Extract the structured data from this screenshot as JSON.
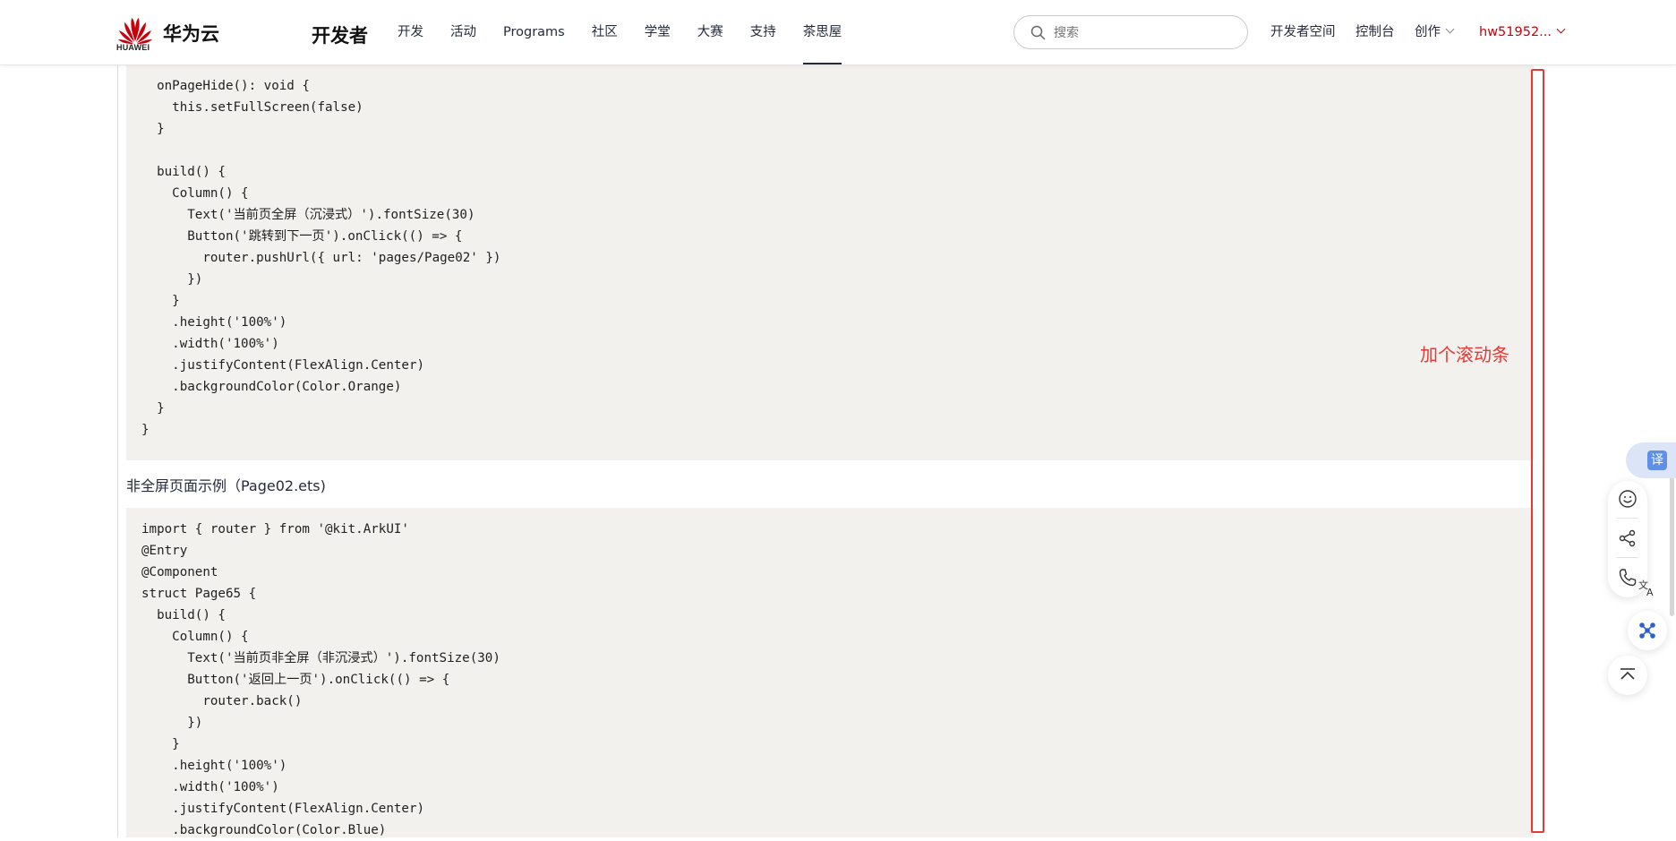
{
  "header": {
    "brand_logo_text": "HUAWEI",
    "brand_name": "华为云",
    "section_title": "开发者",
    "nav": [
      "开发",
      "活动",
      "Programs",
      "社区",
      "学堂",
      "大赛",
      "支持",
      "茶思屋"
    ],
    "active_nav_index": 7,
    "search_placeholder": "搜索",
    "links": {
      "dev_space": "开发者空间",
      "console": "控制台",
      "create": "创作",
      "user": "hw51952..."
    }
  },
  "content": {
    "code_block_1": [
      "  onPageHide(): void {",
      "    this.setFullScreen(false)",
      "  }",
      "",
      "  build() {",
      "    Column() {",
      "      Text('当前页全屏（沉浸式）').fontSize(30)",
      "      Button('跳转到下一页').onClick(() => {",
      "        router.pushUrl({ url: 'pages/Page02' })",
      "      })",
      "    }",
      "    .height('100%')",
      "    .width('100%')",
      "    .justifyContent(FlexAlign.Center)",
      "    .backgroundColor(Color.Orange)",
      "  }",
      "}"
    ],
    "caption": "非全屏页面示例（Page02.ets)",
    "code_block_2": [
      "import { router } from '@kit.ArkUI'",
      "@Entry",
      "@Component",
      "struct Page65 {",
      "  build() {",
      "    Column() {",
      "      Text('当前页非全屏（非沉浸式）').fontSize(30)",
      "      Button('返回上一页').onClick(() => {",
      "        router.back()",
      "      })",
      "    }",
      "    .height('100%')",
      "    .width('100%')",
      "    .justifyContent(FlexAlign.Center)",
      "    .backgroundColor(Color.Blue)"
    ]
  },
  "annotation": {
    "text": "加个滚动条",
    "color": "#e53935"
  },
  "float_tools": {
    "translate_label": "译",
    "icons": [
      "smiley-icon",
      "share-icon",
      "phone-icon",
      "translate-ai-icon",
      "ai-assistant-icon",
      "back-to-top-icon"
    ]
  },
  "colors": {
    "brand_red": "#c7000b",
    "code_bg": "#f3f1ee",
    "accent_blue": "#5f8fe6"
  }
}
